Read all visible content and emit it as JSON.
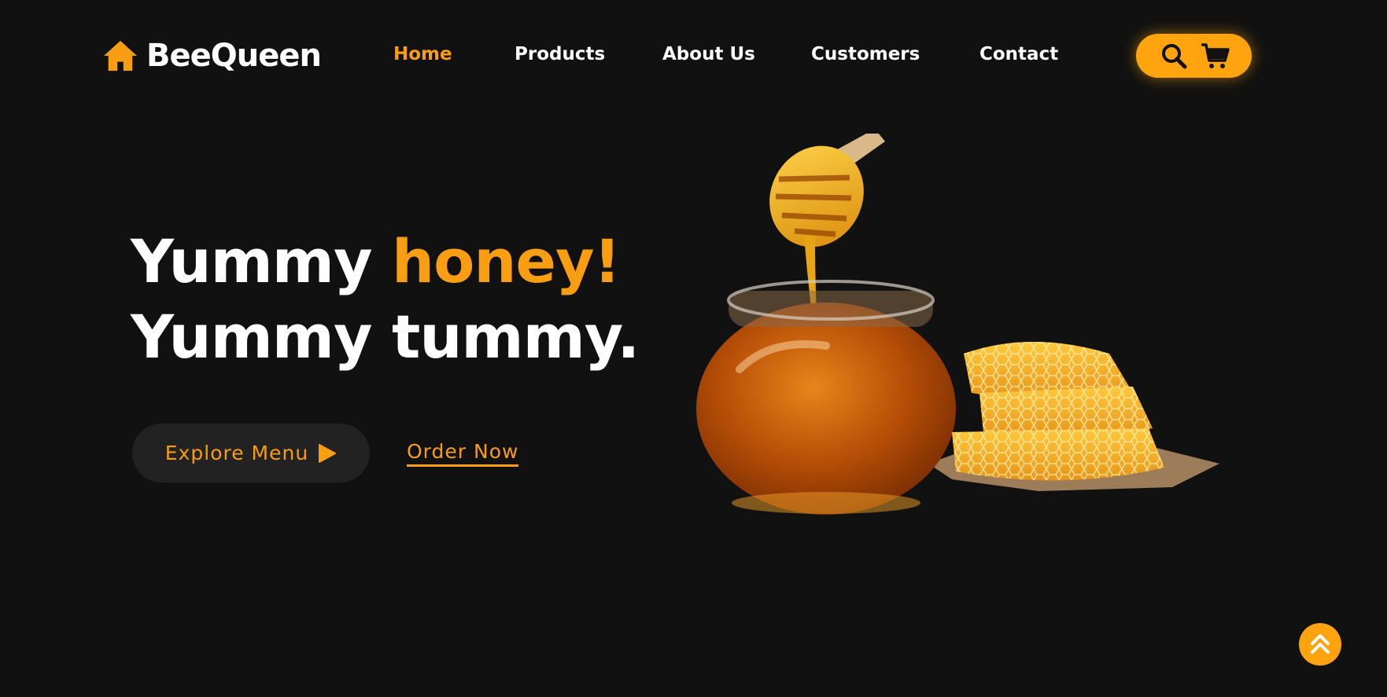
{
  "brand": {
    "name": "BeeQueen",
    "icon": "house-icon"
  },
  "nav": {
    "items": [
      {
        "label": "Home",
        "active": true
      },
      {
        "label": "Products",
        "active": false
      },
      {
        "label": "About Us",
        "active": false
      },
      {
        "label": "Customers",
        "active": false
      },
      {
        "label": "Contact",
        "active": false
      }
    ]
  },
  "tools": {
    "search_icon": "search-icon",
    "cart_icon": "cart-icon"
  },
  "hero": {
    "line1_prefix": "Yummy ",
    "line1_accent": "honey!",
    "line2": "Yummy tummy.",
    "explore_label": "Explore Menu",
    "order_label": "Order Now"
  },
  "colors": {
    "accent": "#f99d12",
    "background": "#111111",
    "button_bg": "#222222"
  }
}
